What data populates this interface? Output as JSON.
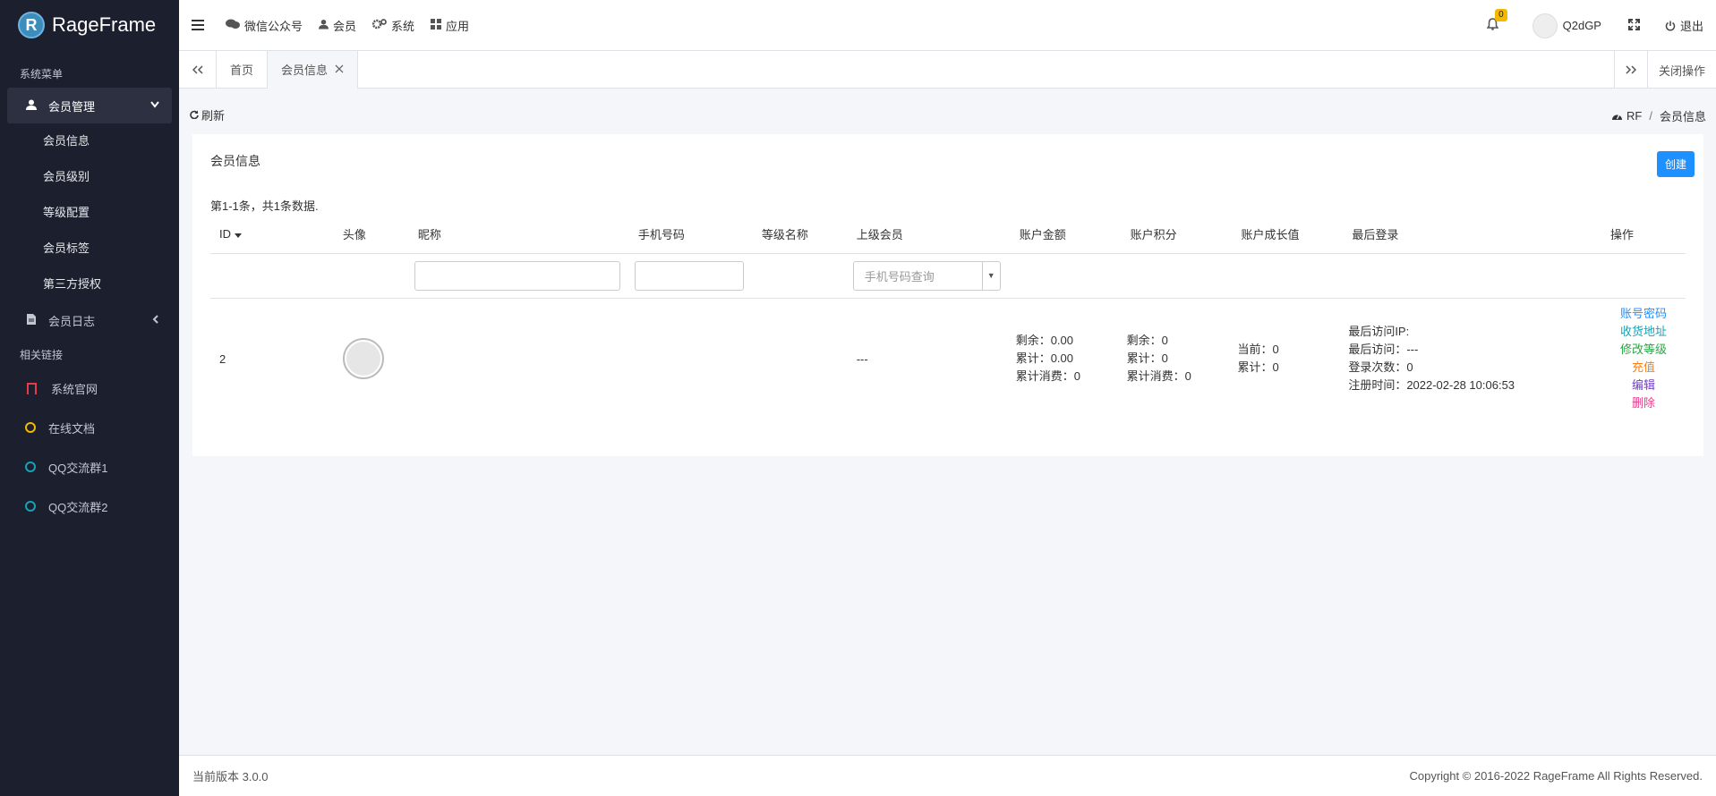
{
  "brand": {
    "name": "RageFrame",
    "logo_letter": "R"
  },
  "sidebar": {
    "header_system": "系统菜单",
    "member_mgmt": "会员管理",
    "sub_items": [
      "会员信息",
      "会员级别",
      "等级配置",
      "会员标签",
      "第三方授权"
    ],
    "member_log": "会员日志",
    "header_links": "相关链接",
    "links": [
      "系统官网",
      "在线文档",
      "QQ交流群1",
      "QQ交流群2"
    ]
  },
  "navbar": {
    "items": [
      "微信公众号",
      "会员",
      "系统",
      "应用"
    ],
    "notification_count": "0",
    "username": "Q2dGP",
    "logout": "退出"
  },
  "tabs": {
    "home": "首页",
    "current": "会员信息",
    "close_ops": "关闭操作"
  },
  "content": {
    "refresh": "刷新",
    "breadcrumb_root": "RF",
    "breadcrumb_sep": "/",
    "breadcrumb_current": "会员信息"
  },
  "card": {
    "title": "会员信息",
    "create_button": "创建",
    "summary": "第1-1条，共1条数据.",
    "columns": [
      "ID",
      "头像",
      "昵称",
      "手机号码",
      "等级名称",
      "上级会员",
      "账户金额",
      "账户积分",
      "账户成长值",
      "最后登录",
      "操作"
    ],
    "filter_placeholder": "手机号码查询",
    "row": {
      "id": "2",
      "parent": "---",
      "balance": [
        "剩余：0.00",
        "累计：0.00",
        "累计消费：0"
      ],
      "points": [
        "剩余：0",
        "累计：0",
        "累计消费：0"
      ],
      "growth": [
        "当前：0",
        "累计：0"
      ],
      "login": [
        "最后访问IP:",
        "最后访问：---",
        "登录次数：0",
        "注册时间：2022-02-28 10:06:53"
      ],
      "actions": [
        "账号密码",
        "收货地址",
        "修改等级",
        "充值",
        "编辑",
        "删除"
      ]
    }
  },
  "footer": {
    "version": "当前版本 3.0.0",
    "copyright": "Copyright © 2016-2022 RageFrame All Rights Reserved."
  },
  "colors": {
    "sidebar_bg": "#1b1f2e",
    "primary": "#1e90ff",
    "action_password": "#1e90ff",
    "action_address": "#17a2b8",
    "action_level": "#28a745",
    "action_recharge": "#fd7e14",
    "action_edit": "#6f42c1",
    "action_delete": "#e83e8c"
  }
}
